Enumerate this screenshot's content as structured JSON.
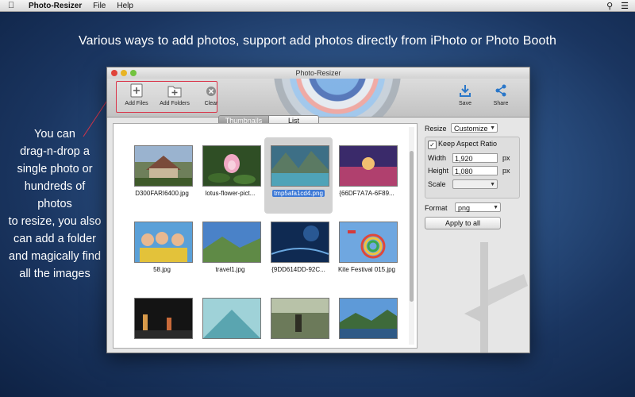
{
  "menubar": {
    "app_name": "Photo-Resizer",
    "menus": [
      "File",
      "Help"
    ],
    "right_icons": [
      "search-icon",
      "list-icon"
    ]
  },
  "headline": "Various ways to add photos, support add photos directly from iPhoto or Photo Booth",
  "side_copy": [
    "You can",
    "drag-n-drop a",
    "single photo or",
    "hundreds of photos",
    "to resize, you also",
    "can add a folder",
    "and magically find",
    "all the images"
  ],
  "window": {
    "title": "Photo-Resizer",
    "toolbar": {
      "add_files": "Add Files",
      "add_folders": "Add Folders",
      "clear": "Clear",
      "save": "Save",
      "share": "Share"
    },
    "view_toggle": {
      "thumbnails": "Thumbnails",
      "list": "List",
      "selected": "Thumbnails"
    },
    "files": [
      {
        "name": "D300FARI6400.jpg"
      },
      {
        "name": "lotus-flower-pict..."
      },
      {
        "name": "tmp5afa1cd4.png",
        "selected": true
      },
      {
        "name": "{66DF7A7A-6F89..."
      },
      {
        "name": "58.jpg"
      },
      {
        "name": "travel1.jpg"
      },
      {
        "name": "{9DD614DD-92C..."
      },
      {
        "name": "Kite Festival 015.jpg"
      },
      {
        "name": ""
      },
      {
        "name": ""
      },
      {
        "name": ""
      },
      {
        "name": ""
      }
    ],
    "settings": {
      "resize_label": "Resize",
      "resize_value": "Customize",
      "keep_aspect_label": "Keep Aspect Ratio",
      "keep_aspect_checked": true,
      "width_label": "Width",
      "width_value": "1,920",
      "height_label": "Height",
      "height_value": "1,080",
      "unit": "px",
      "scale_label": "Scale",
      "scale_value": "",
      "format_label": "Format",
      "format_value": "png",
      "apply_button": "Apply to all"
    }
  },
  "colors": {
    "highlight_border": "#d9354a",
    "selection_blue": "#3d79d6",
    "desktop_dark": "#0e2244"
  }
}
